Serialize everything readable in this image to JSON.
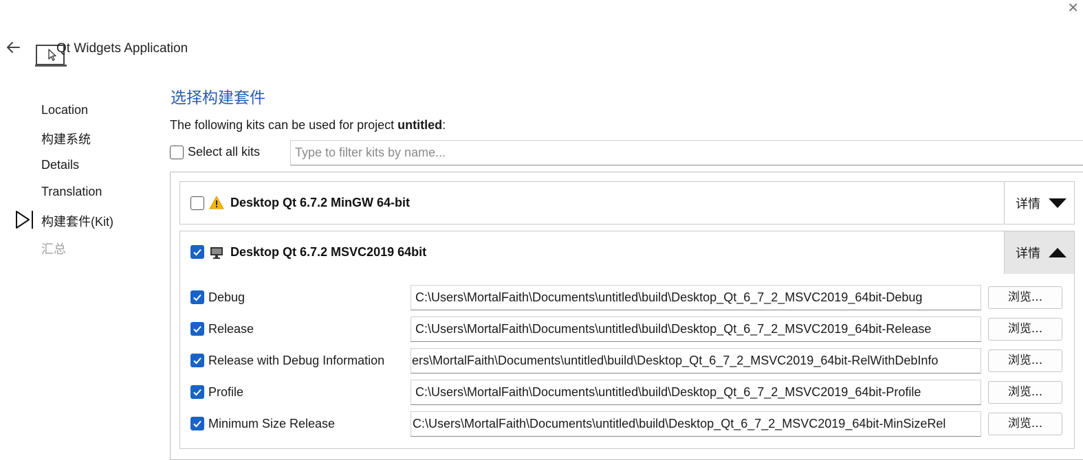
{
  "window": {
    "close_glyph": "✕"
  },
  "header": {
    "title": "Qt Widgets Application",
    "back_icon": "arrow-left-icon",
    "app_icon": "qt-widgets-app-icon"
  },
  "steps": [
    {
      "label": "Location",
      "state": "done"
    },
    {
      "label": "构建系统",
      "state": "done"
    },
    {
      "label": "Details",
      "state": "done"
    },
    {
      "label": "Translation",
      "state": "done"
    },
    {
      "label": "构建套件(Kit)",
      "state": "current"
    },
    {
      "label": "汇总",
      "state": "pending"
    }
  ],
  "page": {
    "title": "选择构建套件",
    "intro_prefix": "The following kits can be used for project ",
    "project_name": "untitled",
    "intro_suffix": ":"
  },
  "select_all": {
    "label": "Select all kits",
    "checked": false
  },
  "filter": {
    "placeholder": "Type to filter kits by name...",
    "value": ""
  },
  "kits": [
    {
      "name": "Desktop Qt 6.7.2 MinGW 64-bit",
      "checked": false,
      "icon": "warning-icon",
      "details_label": "详情",
      "expanded": false
    },
    {
      "name": "Desktop Qt 6.7.2 MSVC2019 64bit",
      "checked": true,
      "icon": "desktop-monitor-icon",
      "details_label": "详情",
      "expanded": true,
      "configs": [
        {
          "name": "Debug",
          "checked": true,
          "path": "C:\\Users\\MortalFaith\\Documents\\untitled\\build\\Desktop_Qt_6_7_2_MSVC2019_64bit-Debug",
          "browse": "浏览..."
        },
        {
          "name": "Release",
          "checked": true,
          "path": "C:\\Users\\MortalFaith\\Documents\\untitled\\build\\Desktop_Qt_6_7_2_MSVC2019_64bit-Release",
          "browse": "浏览..."
        },
        {
          "name": "Release with Debug Information",
          "checked": true,
          "path": "ers\\MortalFaith\\Documents\\untitled\\build\\Desktop_Qt_6_7_2_MSVC2019_64bit-RelWithDebInfo",
          "browse": "浏览..."
        },
        {
          "name": "Profile",
          "checked": true,
          "path": "C:\\Users\\MortalFaith\\Documents\\untitled\\build\\Desktop_Qt_6_7_2_MSVC2019_64bit-Profile",
          "browse": "浏览..."
        },
        {
          "name": "Minimum Size Release",
          "checked": true,
          "path": "C:\\Users\\MortalFaith\\Documents\\untitled\\build\\Desktop_Qt_6_7_2_MSVC2019_64bit-MinSizeRel",
          "browse": "浏览..."
        }
      ]
    }
  ],
  "colors": {
    "accent": "#1a63c6",
    "title_blue": "#2a5db0",
    "warning": "#f2b705",
    "dim_text": "#a0a0a0"
  }
}
